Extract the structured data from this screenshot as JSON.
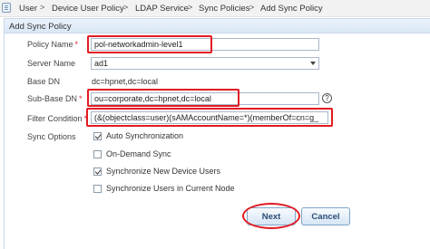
{
  "breadcrumb": {
    "items": [
      "User",
      "Device User Policy",
      "LDAP Service",
      "Sync Policies",
      "Add Sync Policy"
    ],
    "separator": ">"
  },
  "panel": {
    "title": "Add Sync Policy"
  },
  "form": {
    "policy_name": {
      "label": "Policy Name",
      "required": "*",
      "value": "pol-networkadmin-level1"
    },
    "server_name": {
      "label": "Server Name",
      "value": "ad1"
    },
    "base_dn": {
      "label": "Base DN",
      "value": "dc=hpnet,dc=local"
    },
    "sub_base_dn": {
      "label": "Sub-Base DN",
      "required": "*",
      "value": "ou=corporate,dc=hpnet,dc=local"
    },
    "filter_condition": {
      "label": "Filter Condition",
      "required": "*",
      "value": "(&(objectclass=user)(sAMAccountName=*)(memberOf=cn=g_"
    },
    "sync_options": {
      "label": "Sync Options",
      "items": [
        {
          "label": "Auto Synchronization",
          "checked": true
        },
        {
          "label": "On-Demand Sync",
          "checked": false
        },
        {
          "label": "Synchronize New Device Users",
          "checked": true
        },
        {
          "label": "Synchronize Users in Current Node",
          "checked": false
        }
      ]
    }
  },
  "help": {
    "symbol": "?"
  },
  "buttons": {
    "next": "Next",
    "cancel": "Cancel"
  },
  "colors": {
    "highlight": "#e21b22",
    "header": "#d9e7f6",
    "button_text": "#2a4d74"
  }
}
